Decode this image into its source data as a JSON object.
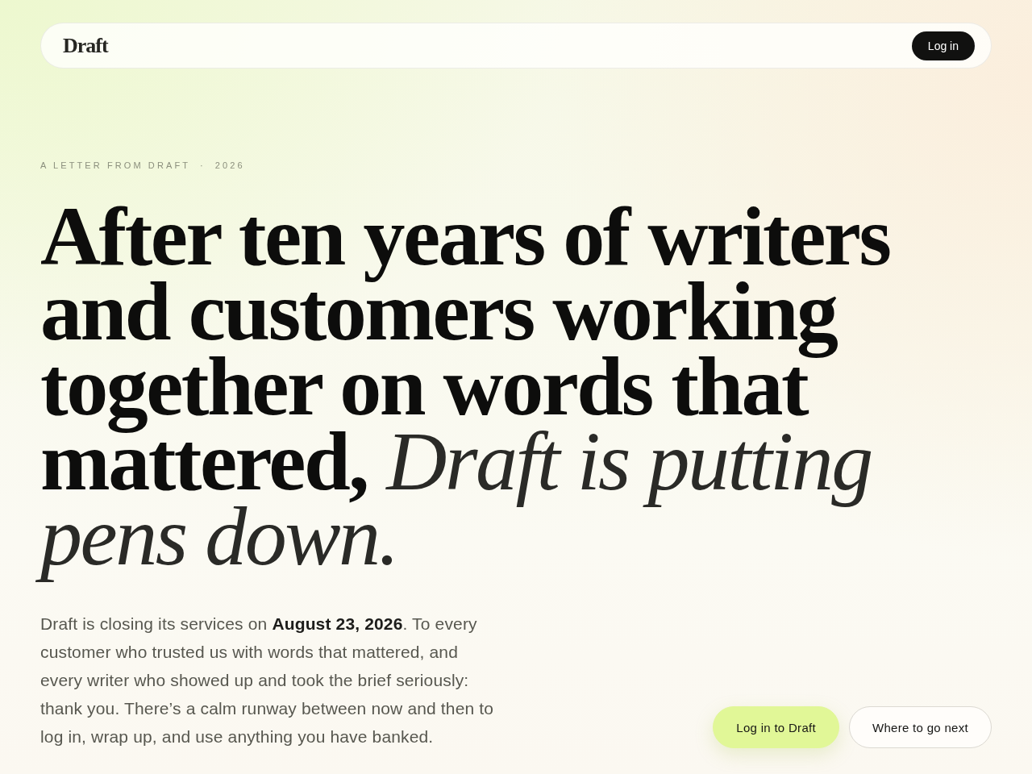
{
  "nav": {
    "logo": "Draft",
    "login_button": "Log in"
  },
  "eyebrow": {
    "label": "A LETTER FROM DRAFT",
    "separator": "·",
    "year": "2026"
  },
  "headline": "After ten years of writers and customers working together on words that mattered, *Draft is putting pens down.*",
  "intro": "Draft is closing its services on **August 23, 2026**. To every customer who trusted us with words that mattered, and every writer who showed up and took the brief seriously: thank you. There’s a calm runway between now and then to log in, wrap up, and use anything you have banked.",
  "actions": [
    {
      "label": "Log in to Draft",
      "kind": "primary"
    },
    {
      "label": "Where to go next",
      "kind": "secondary"
    }
  ]
}
